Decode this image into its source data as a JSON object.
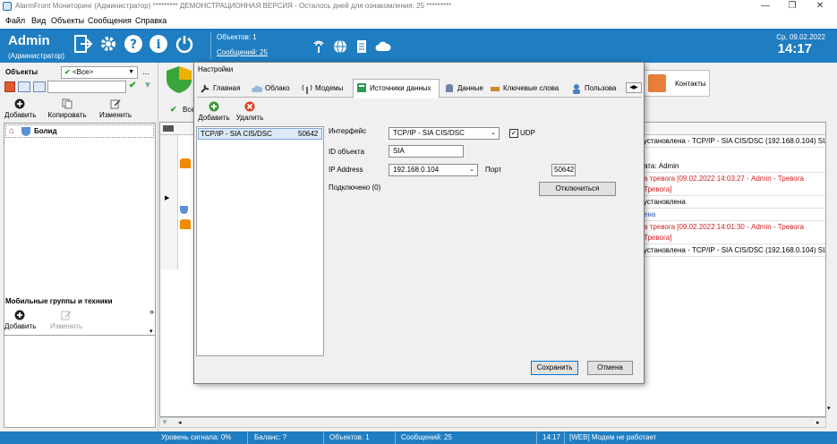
{
  "window": {
    "title": "AlarmFront Мониторинг (Администратор) ********* ДЕМОНСТРАЦИОННАЯ ВЕРСИЯ - Осталось дней для ознакомления: 25 *********"
  },
  "menu": {
    "items": [
      "Файл",
      "Вид",
      "Объекты",
      "Сообщения",
      "Справка"
    ]
  },
  "header": {
    "user": "Admin",
    "role": "(Администратор)",
    "objects": "Объектов: 1",
    "messages": "Сообщений: 25",
    "date": "Ср, 09.02.2022",
    "time": "14:17",
    "color": "#1f7dc1"
  },
  "left": {
    "objects_label": "Объекты",
    "filter_value": "<Все>",
    "more": "...",
    "buttons": {
      "add": "Добавить",
      "copy": "Копировать",
      "edit": "Изменить"
    },
    "tree": [
      {
        "label": "Болид"
      }
    ],
    "mobile_label": "Мобильные группы и техники",
    "mobile_buttons": {
      "add": "Добавить",
      "edit": "Изменить"
    }
  },
  "main": {
    "contacts_tab": "Контакты",
    "all_label": "Все",
    "events": [
      {
        "text": "установлена - TCP/IP - SIA CIS/DSC (192.168.0.104) SIA",
        "kind": "normal"
      },
      {
        "text": "ата: Admin",
        "kind": "normal"
      },
      {
        "text": "а тревога [09.02.2022 14:03:27 - Admin - Тревога",
        "kind": "alarm"
      },
      {
        "text": "Тревога]",
        "kind": "alarm"
      },
      {
        "text": "установлена",
        "kind": "normal"
      },
      {
        "text": "ена",
        "kind": "info"
      },
      {
        "text": "а тревога [09.02.2022 14:01:30 - Admin - Тревога",
        "kind": "alarm"
      },
      {
        "text": "Тревога]",
        "kind": "alarm"
      },
      {
        "text": "установлена - TCP/IP - SIA CIS/DSC (192.168.0.104) SIA",
        "kind": "normal"
      }
    ]
  },
  "dialog": {
    "title": "Настройки",
    "tabs": [
      "Главная",
      "Облако",
      "Модемы",
      "Источники данных",
      "Данные",
      "Ключевые слова",
      "Пользова"
    ],
    "active_tab": "Источники данных",
    "toolbar": {
      "add": "Добавить",
      "delete": "Удалить"
    },
    "sources": [
      {
        "name": "TCP/IP - SIA CIS/DSC",
        "port": "50642"
      }
    ],
    "form": {
      "interface_label": "Интерфейс",
      "interface_value": "TCP/IP - SIA CIS/DSC",
      "udp_label": "UDP",
      "udp_checked": true,
      "object_id_label": "ID объекта",
      "object_id_value": "SIA",
      "ip_label": "IP Address",
      "ip_value": "192.168.0.104",
      "port_label": "Порт",
      "port_value": "50642",
      "connected_label": "Подключено (0)",
      "disconnect_button": "Отключиться"
    },
    "save_button": "Сохранить",
    "cancel_button": "Отмена"
  },
  "status": {
    "signal": "Уровень сигнала: 0%",
    "balance": "Баланс: ?",
    "objects": "Объектов: 1",
    "messages": "Сообщений: 25",
    "time": "14:17",
    "modem": "[WEB] Модем не работает"
  }
}
